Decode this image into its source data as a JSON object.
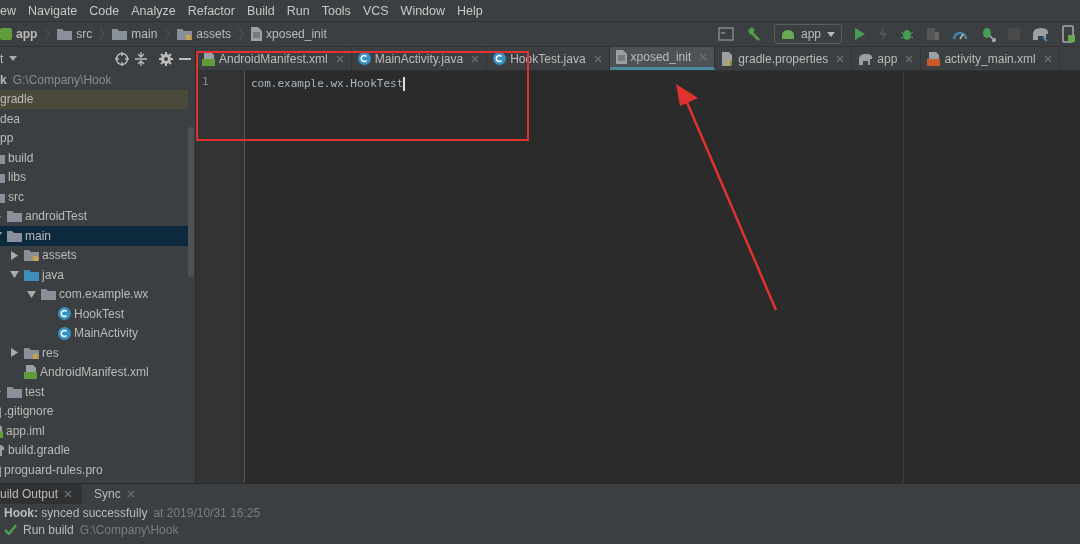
{
  "menu_bar": {
    "items": [
      "ew",
      "Navigate",
      "Code",
      "Analyze",
      "Refactor",
      "Build",
      "Run",
      "Tools",
      "VCS",
      "Window",
      "Help"
    ]
  },
  "breadcrumb": [
    {
      "label": "app",
      "kind": "module"
    },
    {
      "label": "src",
      "kind": "folder"
    },
    {
      "label": "main",
      "kind": "folder"
    },
    {
      "label": "assets",
      "kind": "resfolder"
    },
    {
      "label": "xposed_init",
      "kind": "file"
    }
  ],
  "run_config": {
    "label": "app"
  },
  "project_panel": {
    "title": "t",
    "root": {
      "name": "k",
      "path": "G:\\Company\\Hook"
    },
    "tree": [
      {
        "name": "gradle",
        "marked": true,
        "selected": false
      },
      {
        "name": "dea",
        "marked": false,
        "selected": false
      },
      {
        "name": "pp",
        "marked": false,
        "selected": false,
        "children": [
          {
            "name": "build",
            "kind": "folder",
            "marked": false,
            "selected": false
          },
          {
            "name": "libs",
            "kind": "folder",
            "marked": false,
            "selected": false
          },
          {
            "name": "src",
            "kind": "folder",
            "marked": false,
            "selected": false,
            "children": [
              {
                "name": "androidTest",
                "kind": "folder",
                "marked": false,
                "selected": false,
                "expanded": false
              },
              {
                "name": "main",
                "kind": "folder",
                "marked": false,
                "selected": true,
                "expanded": true,
                "children": [
                  {
                    "name": "assets",
                    "kind": "resfolder",
                    "marked": false,
                    "selected": false,
                    "expanded": false
                  },
                  {
                    "name": "java",
                    "kind": "srcfolder",
                    "marked": false,
                    "selected": false,
                    "expanded": true,
                    "children": [
                      {
                        "name": "com.example.wx",
                        "kind": "package",
                        "marked": false,
                        "selected": false,
                        "expanded": true,
                        "children": [
                          {
                            "name": "HookTest",
                            "kind": "class",
                            "marked": false,
                            "selected": false
                          },
                          {
                            "name": "MainActivity",
                            "kind": "class",
                            "marked": false,
                            "selected": false
                          }
                        ]
                      }
                    ]
                  },
                  {
                    "name": "res",
                    "kind": "resfolder",
                    "marked": false,
                    "selected": false,
                    "expanded": false
                  },
                  {
                    "name": "AndroidManifest.xml",
                    "kind": "xml",
                    "marked": false,
                    "selected": false
                  }
                ]
              },
              {
                "name": "test",
                "kind": "folder",
                "marked": false,
                "selected": false,
                "expanded": false
              }
            ]
          },
          {
            "name": ".gitignore",
            "kind": "text",
            "marked": false,
            "selected": false
          },
          {
            "name": "app.iml",
            "kind": "iml",
            "marked": false,
            "selected": false
          },
          {
            "name": "build.gradle",
            "kind": "gradle",
            "marked": false,
            "selected": false
          },
          {
            "name": "proguard-rules.pro",
            "kind": "text",
            "marked": false,
            "selected": false
          }
        ]
      }
    ]
  },
  "editor_tabs": [
    {
      "label": "AndroidManifest.xml",
      "kind": "xml",
      "selected": false
    },
    {
      "label": "MainActivity.java",
      "kind": "class",
      "selected": false
    },
    {
      "label": "HookTest.java",
      "kind": "class",
      "selected": false
    },
    {
      "label": "xposed_init",
      "kind": "file",
      "selected": true
    },
    {
      "label": "gradle.properties",
      "kind": "props",
      "selected": false
    },
    {
      "label": "app",
      "kind": "gradle",
      "selected": false
    },
    {
      "label": "activity_main.xml",
      "kind": "layout",
      "selected": false
    }
  ],
  "editor": {
    "lines": [
      {
        "number": "1",
        "text": "com.example.wx.HookTest"
      }
    ]
  },
  "build_panel": {
    "tabs": [
      {
        "label": "uild Output",
        "selected": true
      },
      {
        "label": "Sync",
        "selected": false
      }
    ],
    "message": "**Hook:** synced successfully",
    "time": "at 2019/10/31 16:25",
    "steps": [
      {
        "label": "Run build",
        "path": "G:\\Company\\Hook",
        "done": true
      }
    ]
  }
}
